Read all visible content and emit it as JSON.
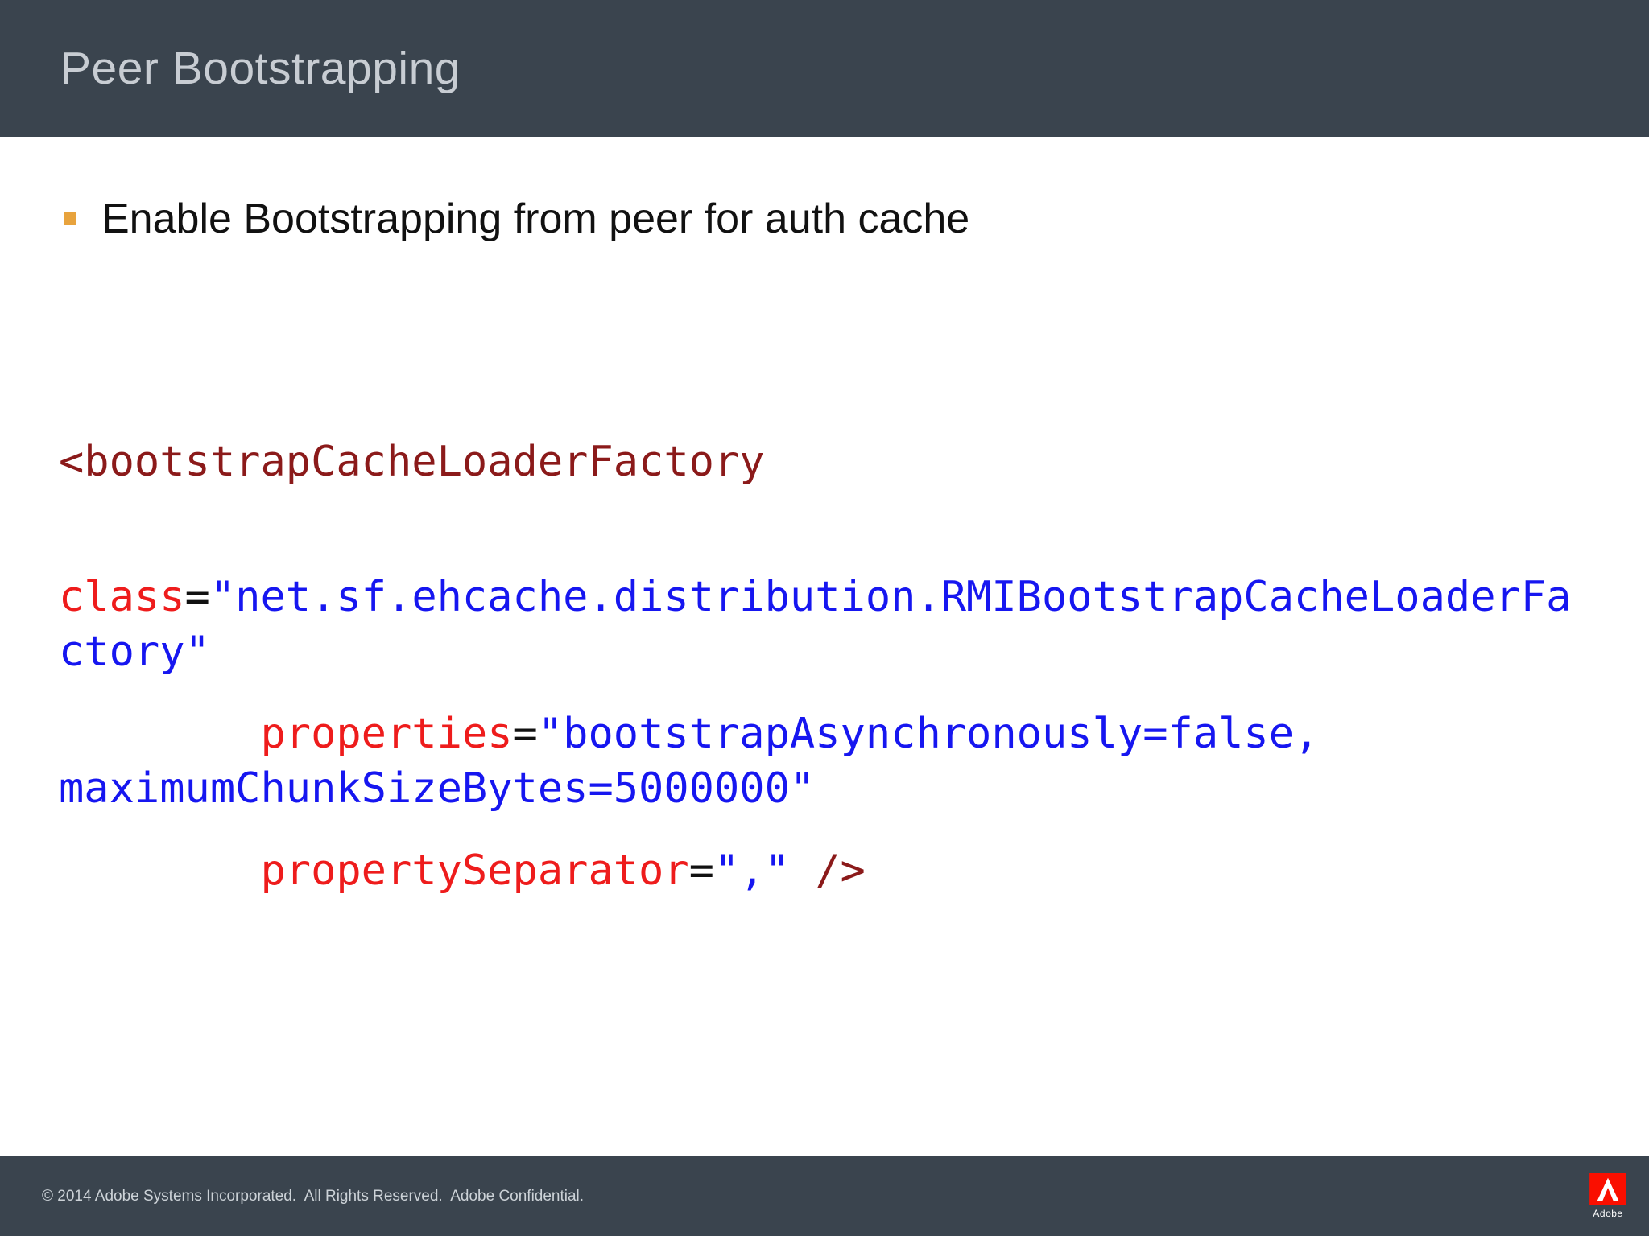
{
  "slide": {
    "title": "Peer Bootstrapping",
    "bullet_text": "Enable Bootstrapping from peer for auth cache",
    "footer_text": "© 2014 Adobe Systems Incorporated.  All Rights Reserved.  Adobe Confidential.",
    "logo_text": "Adobe"
  },
  "colors": {
    "header_bg": "#3a444e",
    "footer_bg": "#3a444e",
    "title_color": "#c8cdd3",
    "bullet_marker": "#e8a33d",
    "body_text": "#111111",
    "code_tag": "#8b1a1a",
    "code_attr": "#ee1c1c",
    "code_value": "#1616f0",
    "code_plain": "#111111",
    "adobe_red": "#fa0f00"
  },
  "code": {
    "language": "xml",
    "paragraphs": [
      {
        "id": "open-tag",
        "gap": "xl",
        "segments": [
          {
            "type": "tag",
            "text": "<bootstrapCacheLoaderFactory"
          }
        ]
      },
      {
        "id": "class-attr",
        "gap": "md",
        "segments": [
          {
            "type": "attr",
            "text": "class"
          },
          {
            "type": "plain",
            "text": "="
          },
          {
            "type": "value",
            "text": "\"net.sf.ehcache.distribution.RMIBootstrapCacheLoaderFa\nctory\""
          }
        ]
      },
      {
        "id": "properties-attr",
        "gap": "md",
        "segments": [
          {
            "type": "plain",
            "text": "        "
          },
          {
            "type": "attr",
            "text": "properties"
          },
          {
            "type": "plain",
            "text": "="
          },
          {
            "type": "value",
            "text": "\"bootstrapAsynchronously=false,\nmaximumChunkSizeBytes=5000000\""
          }
        ]
      },
      {
        "id": "separator-attr",
        "gap": "none",
        "segments": [
          {
            "type": "plain",
            "text": "        "
          },
          {
            "type": "attr",
            "text": "propertySeparator"
          },
          {
            "type": "plain",
            "text": "="
          },
          {
            "type": "value",
            "text": "\",\""
          },
          {
            "type": "plain",
            "text": " "
          },
          {
            "type": "tag",
            "text": "/>"
          }
        ]
      }
    ]
  }
}
